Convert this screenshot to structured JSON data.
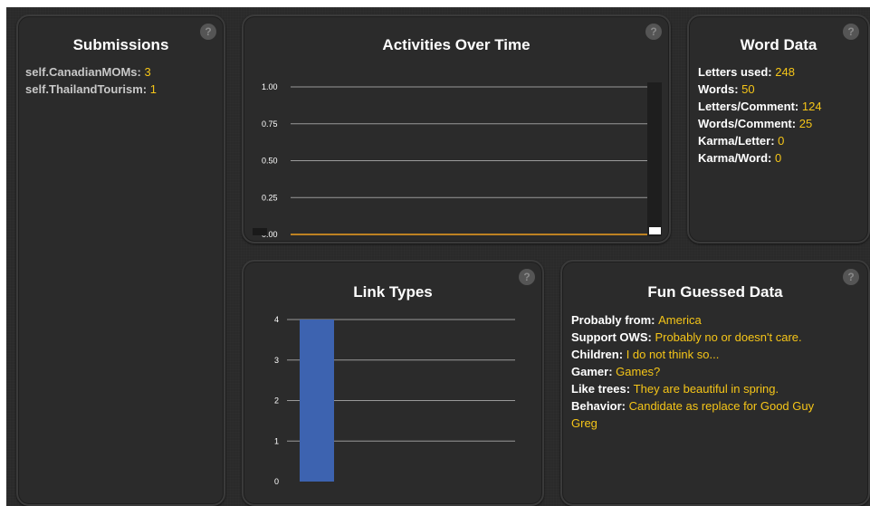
{
  "submissions": {
    "title": "Submissions",
    "items": [
      {
        "label": "self.CanadianMOMs",
        "value": "3"
      },
      {
        "label": "self.ThailandTourism",
        "value": "1"
      }
    ]
  },
  "activities": {
    "title": "Activities Over Time"
  },
  "word_data": {
    "title": "Word Data",
    "items": [
      {
        "label": "Letters used:",
        "value": "248"
      },
      {
        "label": "Words:",
        "value": "50"
      },
      {
        "label": "Letters/Comment:",
        "value": "124"
      },
      {
        "label": "Words/Comment:",
        "value": "25"
      },
      {
        "label": "Karma/Letter:",
        "value": "0"
      },
      {
        "label": "Karma/Word:",
        "value": "0"
      }
    ]
  },
  "link_types": {
    "title": "Link Types"
  },
  "fun_data": {
    "title": "Fun Guessed Data",
    "items": [
      {
        "label": "Probably from:",
        "value": "America"
      },
      {
        "label": "Support OWS:",
        "value": "Probably no or doesn't care."
      },
      {
        "label": "Children:",
        "value": "I do not think so..."
      },
      {
        "label": "Gamer:",
        "value": "Games?"
      },
      {
        "label": "Like trees:",
        "value": "They are beautiful in spring."
      },
      {
        "label": "Behavior:",
        "value": "Candidate as replace for Good Guy Greg"
      }
    ]
  },
  "help_label": "?",
  "colors": {
    "accent": "#f5c518",
    "line": "#f0a020",
    "bar": "#3d63b0"
  },
  "chart_data": [
    {
      "type": "line",
      "title": "Activities Over Time",
      "xlabel": "",
      "ylabel": "",
      "ylim": [
        0,
        1
      ],
      "y_ticks": [
        "1.00",
        "0.75",
        "0.50",
        "0.25",
        "0.00"
      ],
      "series": [
        {
          "values": [
            0,
            0
          ]
        }
      ],
      "grid": true
    },
    {
      "type": "bar",
      "title": "Link Types",
      "xlabel": "",
      "ylabel": "",
      "ylim": [
        0,
        4
      ],
      "y_ticks": [
        "4",
        "3",
        "2",
        "1",
        "0"
      ],
      "categories": [
        ""
      ],
      "values": [
        4
      ],
      "grid": true
    }
  ]
}
